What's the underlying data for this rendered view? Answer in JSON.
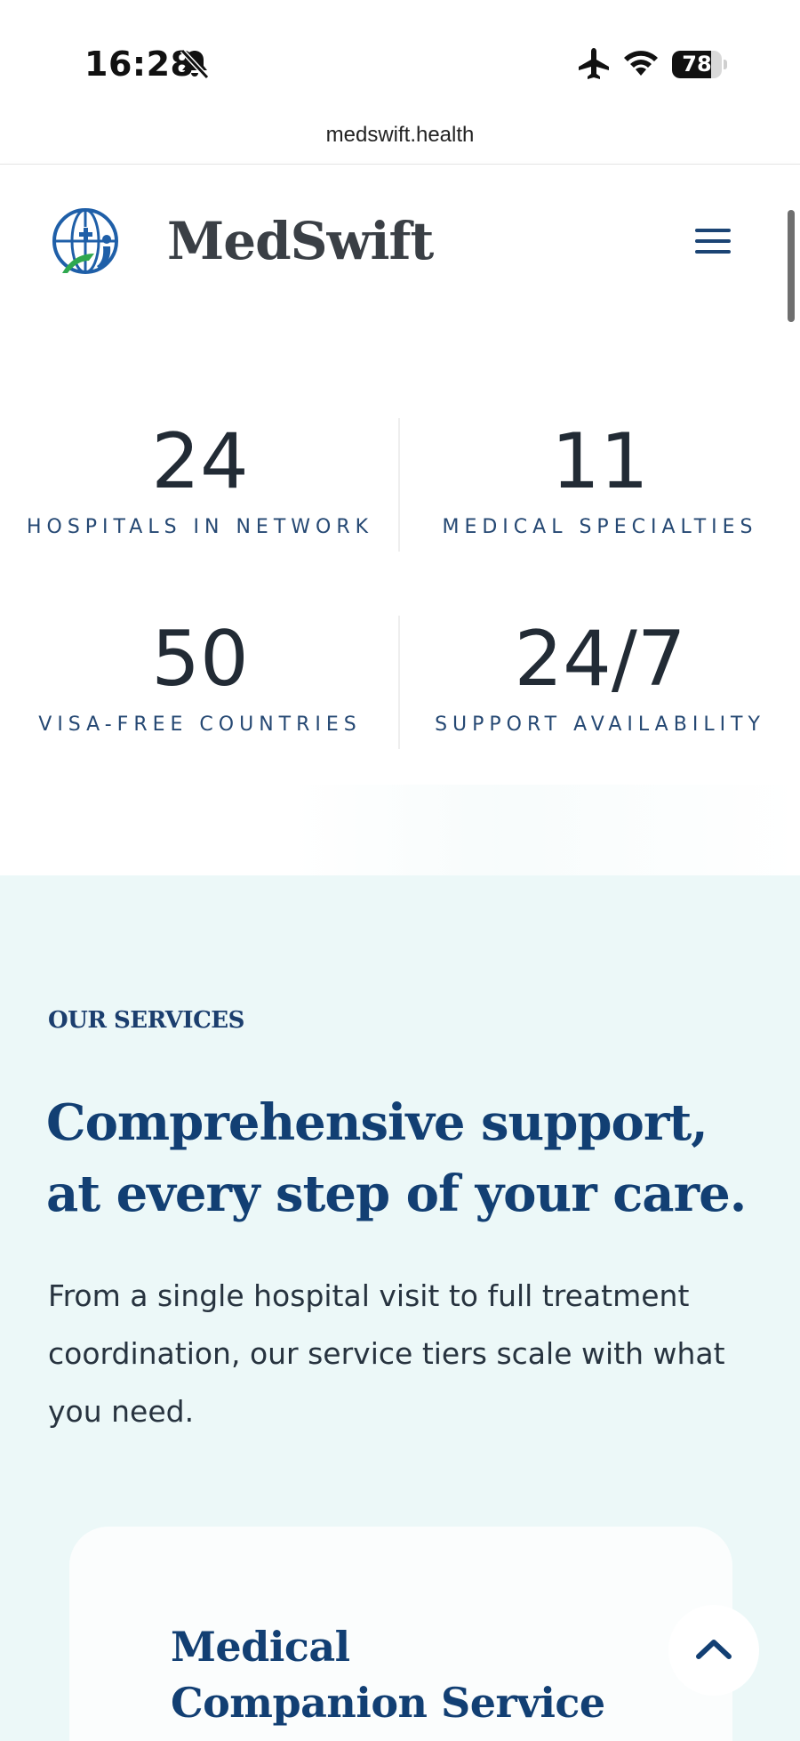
{
  "status_bar": {
    "time": "16:28",
    "battery": "78",
    "battery_level": 0.78,
    "icons": [
      "bell-slash-icon",
      "airplane-icon",
      "wifi-icon",
      "battery-icon"
    ]
  },
  "browser": {
    "url": "medswift.health"
  },
  "header": {
    "brand": "MedSwift",
    "menu_icon": "hamburger-menu-icon",
    "logo_icon": "globe-medical-logo"
  },
  "stats": [
    {
      "value": "24",
      "label": "HOSPITALS IN NETWORK"
    },
    {
      "value": "11",
      "label": "MEDICAL SPECIALTIES"
    },
    {
      "value": "50",
      "label": "VISA-FREE COUNTRIES"
    },
    {
      "value": "24/7",
      "label": "SUPPORT AVAILABILITY"
    }
  ],
  "services": {
    "eyebrow": "OUR SERVICES",
    "title": "Comprehensive support, at every step of your care.",
    "description": "From a single hospital visit to full treatment coordination, our service tiers scale with what you need.",
    "cards": [
      {
        "title": "Medical Companion Service",
        "icon": "chevron-up-icon"
      }
    ]
  },
  "colors": {
    "brand_navy": "#123f73",
    "label_blue": "#254873",
    "services_bg": "#ecf8f8",
    "logo_green": "#2fa84f",
    "logo_blue": "#1f5fa8"
  }
}
